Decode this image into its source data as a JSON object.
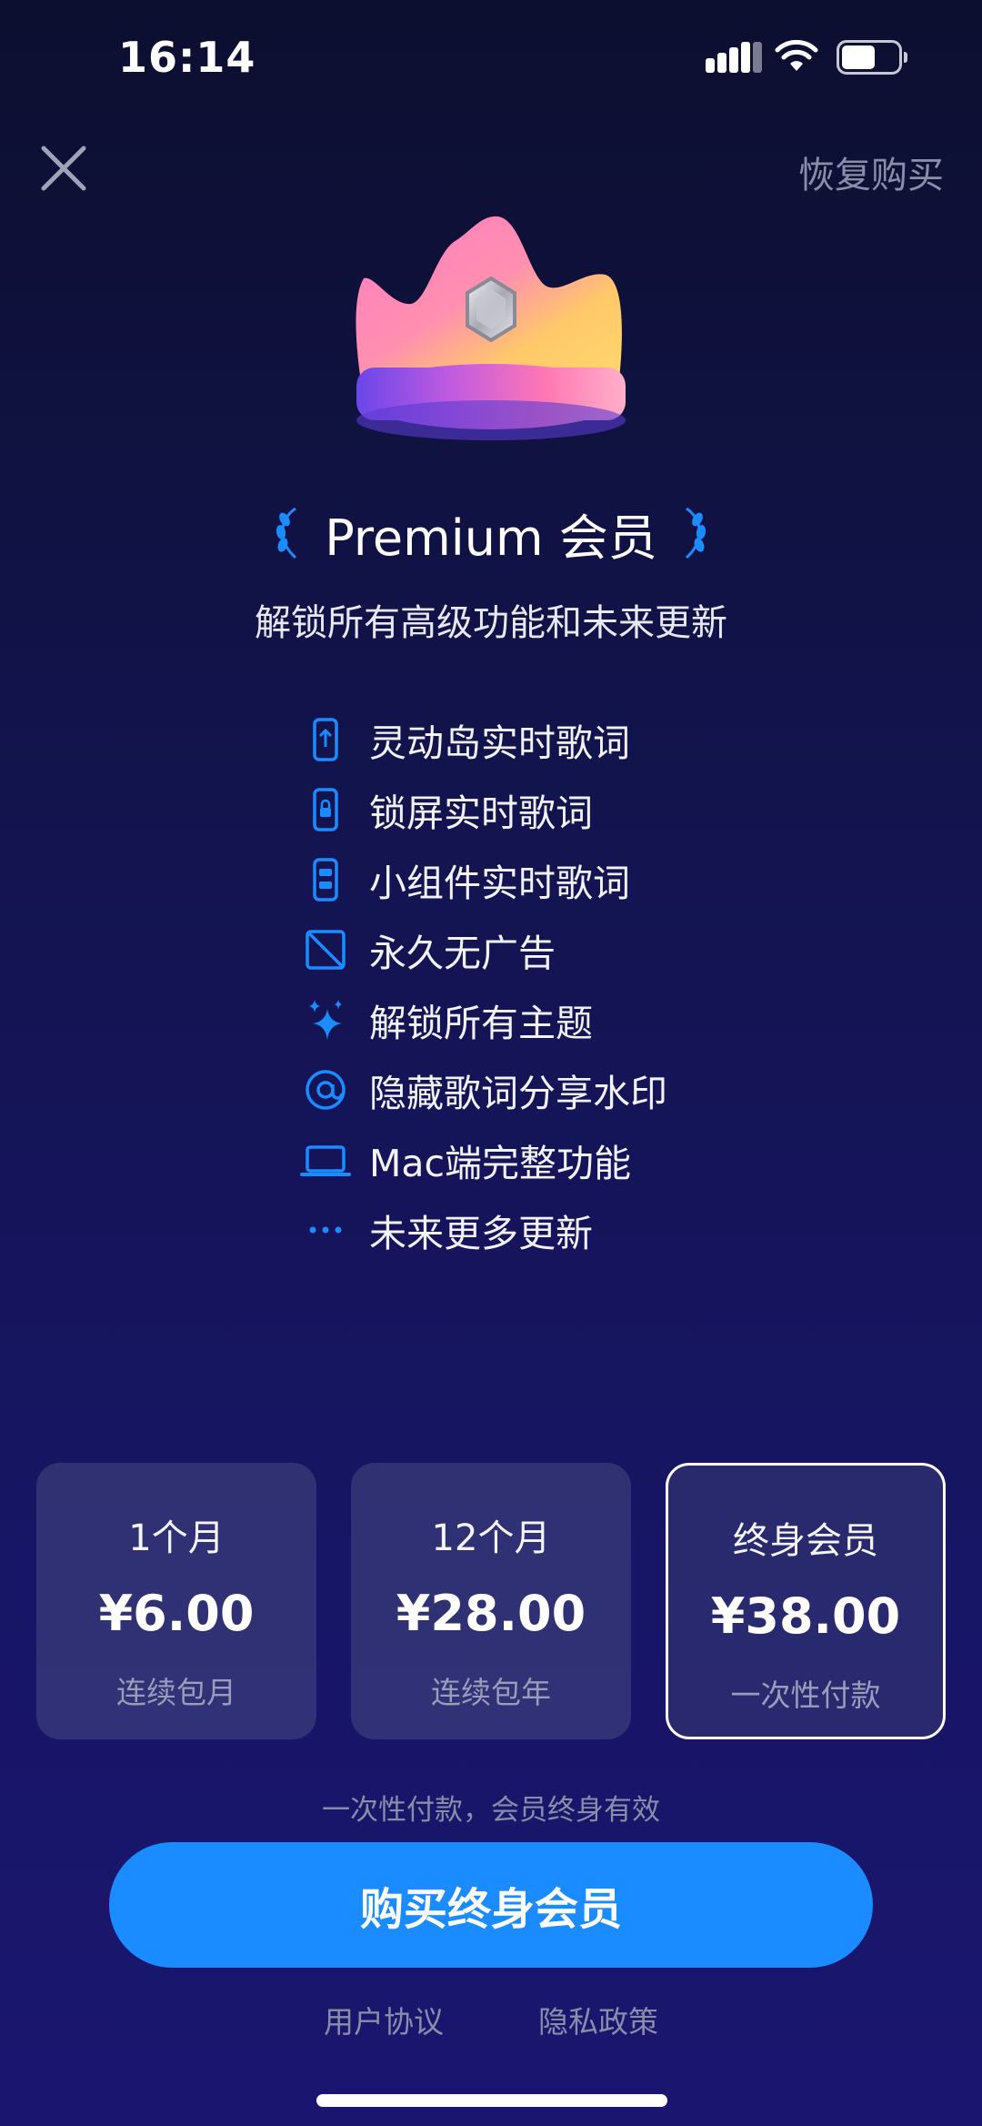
{
  "status_bar": {
    "time": "16:14"
  },
  "nav": {
    "restore_label": "恢复购买"
  },
  "header": {
    "title": "Premium 会员",
    "subtitle": "解锁所有高级功能和未来更新"
  },
  "features": [
    {
      "label": "灵动岛实时歌词",
      "icon": "dynamic-island-icon"
    },
    {
      "label": "锁屏实时歌词",
      "icon": "lock-screen-icon"
    },
    {
      "label": "小组件实时歌词",
      "icon": "widget-icon"
    },
    {
      "label": "永久无广告",
      "icon": "no-ads-icon"
    },
    {
      "label": "解锁所有主题",
      "icon": "sparkles-icon"
    },
    {
      "label": "隐藏歌词分享水印",
      "icon": "at-icon"
    },
    {
      "label": "Mac端完整功能",
      "icon": "laptop-icon"
    },
    {
      "label": "未来更多更新",
      "icon": "ellipsis-icon"
    }
  ],
  "plans": [
    {
      "name": "1个月",
      "price": "¥6.00",
      "desc": "连续包月",
      "selected": false
    },
    {
      "name": "12个月",
      "price": "¥28.00",
      "desc": "连续包年",
      "selected": false
    },
    {
      "name": "终身会员",
      "price": "¥38.00",
      "desc": "一次性付款",
      "selected": true
    }
  ],
  "purchase": {
    "note": "一次性付款，会员终身有效",
    "button_label": "购买终身会员"
  },
  "footer": {
    "terms_label": "用户协议",
    "privacy_label": "隐私政策"
  },
  "colors": {
    "accent": "#1a8cff",
    "background_top": "#0c0f2f",
    "background_bottom": "#1a1670",
    "card_bg": "#464882"
  }
}
